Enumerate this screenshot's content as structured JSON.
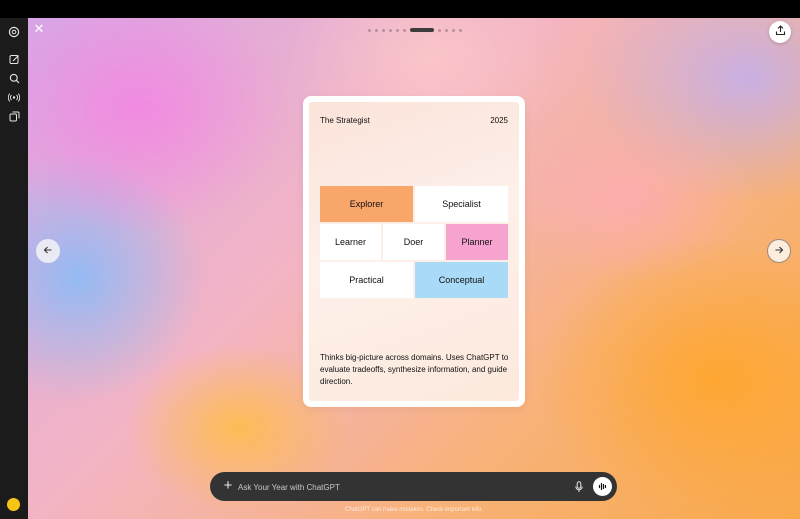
{
  "sidebar": {
    "icons": [
      "chatgpt-logo-icon",
      "new-chat-icon",
      "search-icon",
      "broadcast-icon",
      "library-icon"
    ]
  },
  "carousel": {
    "dots_total": 11,
    "active_index": 6
  },
  "card": {
    "title": "The Strategist",
    "year": "2025",
    "grid": {
      "explorer": "Explorer",
      "specialist": "Specialist",
      "learner": "Learner",
      "doer": "Doer",
      "planner": "Planner",
      "practical": "Practical",
      "conceptual": "Conceptual"
    },
    "description": "Thinks big-picture across domains. Uses ChatGPT to evaluate tradeoffs, synthesize information, and guide direction."
  },
  "composer": {
    "placeholder": "Ask Your Year with ChatGPT"
  },
  "footnote": "ChatGPT can make mistakes. Check important info.",
  "colors": {
    "explorer": "#f9a66b",
    "planner": "#f6a3d0",
    "conceptual": "#a9daf7",
    "avatar": "#f6c414"
  }
}
